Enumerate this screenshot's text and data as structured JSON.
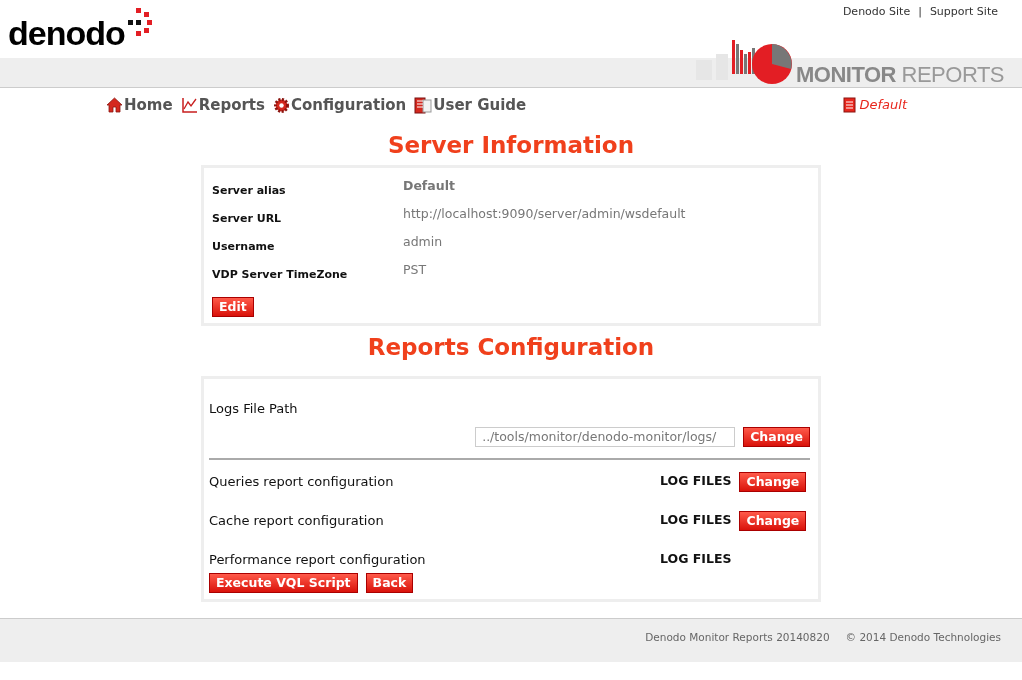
{
  "header": {
    "logo_text": "denodo",
    "links": [
      "Denodo Site",
      "Support Site"
    ],
    "link_separator": "|",
    "banner": {
      "title_bold": "MONITOR",
      "title_light": "REPORTS"
    }
  },
  "nav": {
    "items": [
      {
        "kind": "home",
        "label": "Home"
      },
      {
        "kind": "reports",
        "label": "Reports"
      },
      {
        "kind": "configuration",
        "label": "Configuration"
      },
      {
        "kind": "guide",
        "label": "User Guide"
      }
    ],
    "server": "Default"
  },
  "server_information": {
    "title": "Server Information",
    "fields": [
      {
        "label": "Server alias",
        "value": "Default",
        "bold": true
      },
      {
        "label": "Server URL",
        "value": "http://localhost:9090/server/admin/wsdefault",
        "bold": false
      },
      {
        "label": "Username",
        "value": "admin",
        "bold": false
      },
      {
        "label": "VDP Server TimeZone",
        "value": "PST",
        "bold": false
      }
    ],
    "button": "Edit"
  },
  "reports_configuration": {
    "title": "Reports Configuration",
    "logs_path": {
      "label": "Logs File Path",
      "value": "../tools/monitor/denodo-monitor/logs/",
      "button": "Change"
    },
    "rows": [
      {
        "label": "Queries report configuration",
        "value": "LOG FILES",
        "button": "Change"
      },
      {
        "label": "Cache report configuration",
        "value": "LOG FILES",
        "button": "Change"
      },
      {
        "label": "Performance report configuration",
        "value": "LOG FILES"
      }
    ],
    "buttons": [
      "Execute VQL Script",
      "Back"
    ]
  },
  "footer": {
    "version": "Denodo Monitor Reports 20140820",
    "copyright": "© 2014 Denodo Technologies"
  }
}
